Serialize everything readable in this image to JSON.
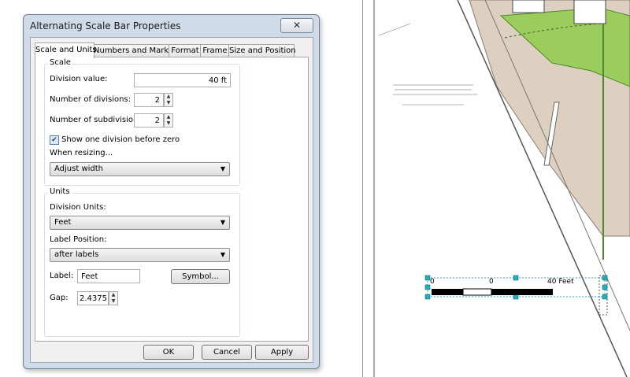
{
  "dialog": {
    "title": "Alternating Scale Bar Properties",
    "close_symbol": "✕",
    "tabs": [
      {
        "label": "Scale and Units",
        "active": true
      },
      {
        "label": "Numbers and Marks",
        "active": false
      },
      {
        "label": "Format",
        "active": false
      },
      {
        "label": "Frame",
        "active": false
      },
      {
        "label": "Size and Position",
        "active": false
      }
    ],
    "scale": {
      "group_label": "Scale",
      "division_value_label": "Division value:",
      "division_value": "40 ft",
      "num_divisions_label": "Number of divisions:",
      "num_divisions": "2",
      "num_subdivisions_label": "Number of subdivisions:",
      "num_subdivisions": "2",
      "show_one_division_label": "Show one division before zero",
      "show_one_division_checked": true,
      "when_resizing_label": "When resizing...",
      "when_resizing_value": "Adjust width"
    },
    "units": {
      "group_label": "Units",
      "division_units_label": "Division Units:",
      "division_units_value": "Feet",
      "label_position_label": "Label Position:",
      "label_position_value": "after labels",
      "label_label": "Label:",
      "label_value": "Feet",
      "symbol_button": "Symbol...",
      "gap_label": "Gap:",
      "gap_value": "2.4375"
    },
    "buttons": {
      "ok": "OK",
      "cancel": "Cancel",
      "apply": "Apply"
    }
  },
  "map": {
    "scalebar_labels": {
      "left": "0",
      "mid": "0",
      "right": "40 Feet"
    },
    "colors": {
      "parcel_green": "#9ccc5e",
      "parcel_tan": "#ddd0c0",
      "selection_cyan": "#20b0b8",
      "road_line": "#4a8a2a"
    }
  }
}
